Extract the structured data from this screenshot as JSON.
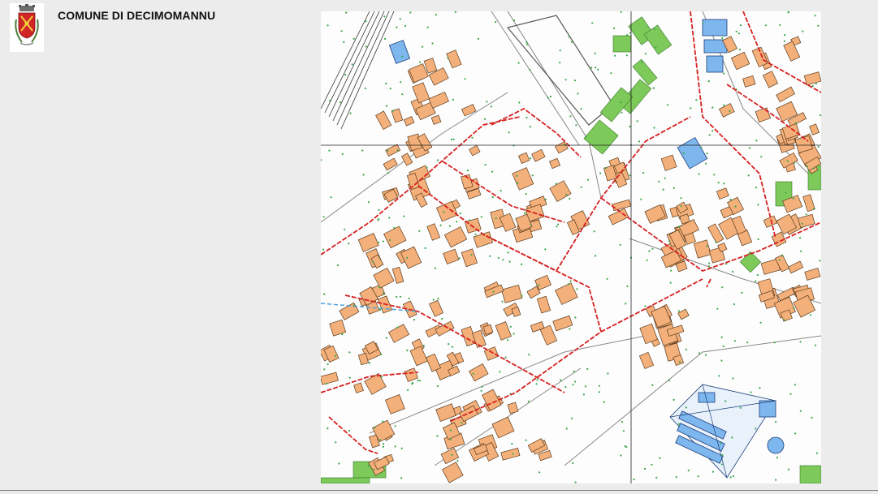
{
  "header": {
    "title": "COMUNE DI DECIMOMANNU",
    "crest_icon": "municipal-coat-of-arms-icon"
  },
  "map": {
    "description_icon": "urban-street-plan-map",
    "colors": {
      "background": "#fdfdfd",
      "building": "#f4b07a",
      "building_outline": "#5a3b1c",
      "public_building": "#7eb6ee",
      "green_area": "#7dc95a",
      "route": "#d62020",
      "tree_dot": "#37a84a",
      "railway": "#333333",
      "grid_line": "#222222",
      "canal": "#4aa3d8"
    }
  }
}
